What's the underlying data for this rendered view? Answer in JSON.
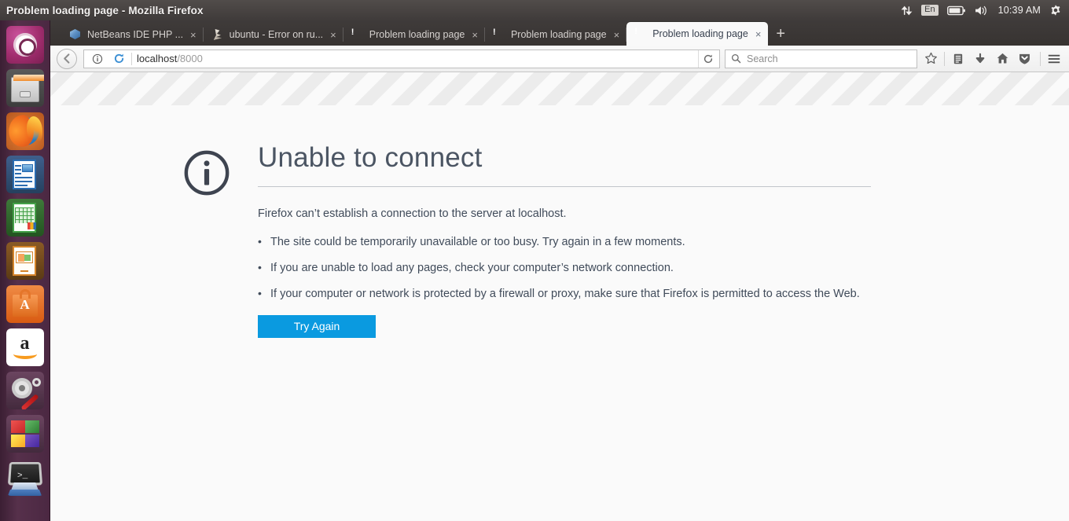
{
  "panel": {
    "window_title": "Problem loading page - Mozilla Firefox",
    "tray": {
      "network_icon": "network-up-down-icon",
      "language": "En",
      "battery_icon": "battery-icon",
      "volume_icon": "volume-icon",
      "clock": "10:39 AM",
      "settings_icon": "gear-icon"
    }
  },
  "launcher": {
    "items": [
      {
        "name": "ubuntu-dash",
        "label": "Ubuntu Dash",
        "active": false
      },
      {
        "name": "files",
        "label": "Files",
        "active": false
      },
      {
        "name": "firefox",
        "label": "Firefox",
        "active": true
      },
      {
        "name": "libreoffice-writer",
        "label": "LibreOffice Writer",
        "active": false
      },
      {
        "name": "libreoffice-calc",
        "label": "LibreOffice Calc",
        "active": false
      },
      {
        "name": "libreoffice-impress",
        "label": "LibreOffice Impress",
        "active": false
      },
      {
        "name": "ubuntu-software",
        "label": "Ubuntu Software",
        "active": false
      },
      {
        "name": "amazon",
        "label": "Amazon",
        "active": false
      },
      {
        "name": "system-settings",
        "label": "System Settings",
        "active": false
      },
      {
        "name": "workspace-switcher",
        "label": "Workspace Switcher",
        "active": false
      },
      {
        "name": "terminal",
        "label": "Terminal",
        "active": false
      }
    ]
  },
  "browser": {
    "tabs": [
      {
        "title": "NetBeans IDE PHP ...",
        "favicon": "cube-icon",
        "active": false,
        "close": "×"
      },
      {
        "title": "ubuntu - Error on ru...",
        "favicon": "java-icon",
        "active": false,
        "close": "×"
      },
      {
        "title": "Problem loading page",
        "favicon": "error-icon",
        "active": false,
        "close": "×"
      },
      {
        "title": "Problem loading page",
        "favicon": "error-icon",
        "active": false,
        "close": "×"
      },
      {
        "title": "Problem loading page",
        "favicon": "error-icon",
        "active": true,
        "close": "×"
      }
    ],
    "new_tab_label": "+",
    "toolbar": {
      "back_icon": "back-arrow-icon",
      "identity_icon": "info-circle-icon",
      "reload_in_url_icon": "reload-icon",
      "url_host": "localhost",
      "url_path": "/8000",
      "reload_icon": "reload-icon",
      "search_icon": "search-icon",
      "search_placeholder": "Search",
      "bookmark_icon": "star-icon",
      "sidebar_icon": "reader-list-icon",
      "downloads_icon": "download-arrow-icon",
      "home_icon": "home-icon",
      "pocket_icon": "pocket-shield-icon",
      "menu_icon": "hamburger-menu-icon"
    }
  },
  "error_page": {
    "icon": "info-circle-icon",
    "title": "Unable to connect",
    "intro": "Firefox can’t establish a connection to the server at localhost.",
    "bullets": [
      "The site could be temporarily unavailable or too busy. Try again in a few moments.",
      "If you are unable to load any pages, check your computer’s network connection.",
      "If your computer or network is protected by a firewall or proxy, make sure that Firefox is permitted to access the Web."
    ],
    "button_label": "Try Again",
    "accent_color": "#0a9ae0",
    "text_color": "#404b5a"
  }
}
